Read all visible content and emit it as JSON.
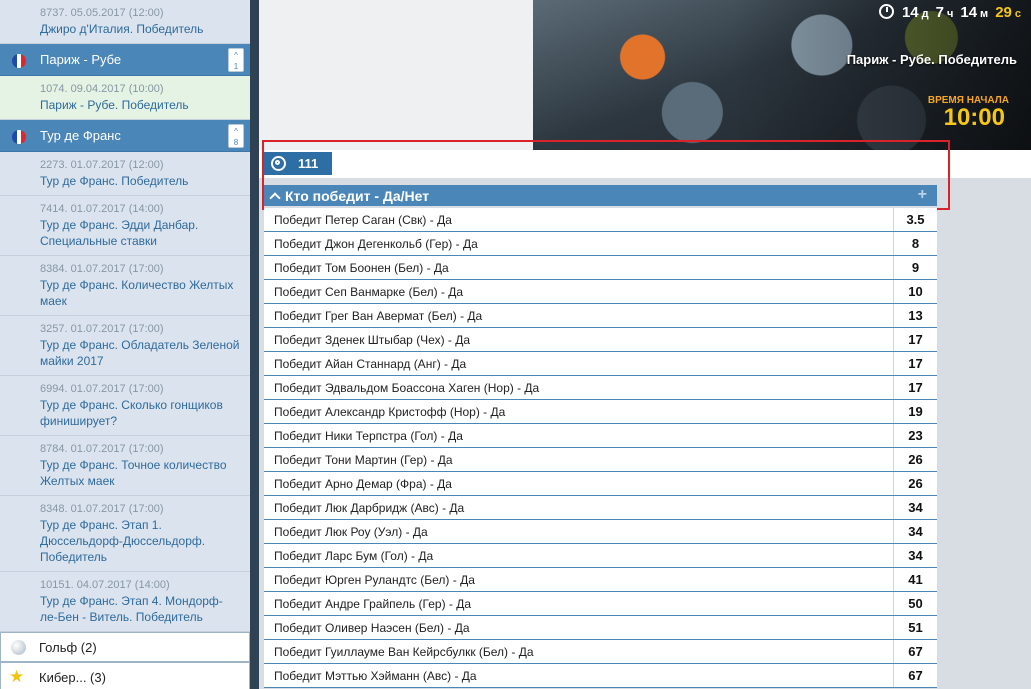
{
  "sidebar": {
    "top_event": {
      "meta": "8737. 05.05.2017 (12:00)",
      "title": "Джиро д'Италия. Победитель"
    },
    "categories": [
      {
        "name": "Париж - Рубе",
        "count": "1",
        "events": [
          {
            "meta": "1074. 09.04.2017 (10:00)",
            "title": "Париж - Рубе. Победитель",
            "active": true
          }
        ]
      },
      {
        "name": "Тур де Франс",
        "count": "8",
        "events": [
          {
            "meta": "2273. 01.07.2017 (12:00)",
            "title": "Тур де Франс. Победитель"
          },
          {
            "meta": "7414. 01.07.2017 (14:00)",
            "title": "Тур де Франс. Эдди Данбар. Специальные ставки"
          },
          {
            "meta": "8384. 01.07.2017 (17:00)",
            "title": "Тур де Франс. Количество Желтых маек"
          },
          {
            "meta": "3257. 01.07.2017 (17:00)",
            "title": "Тур де Франс. Обладатель Зеленой майки 2017"
          },
          {
            "meta": "6994. 01.07.2017 (17:00)",
            "title": "Тур де Франс. Сколько гонщиков финиширует?"
          },
          {
            "meta": "8784. 01.07.2017 (17:00)",
            "title": "Тур де Франс. Точное количество Желтых маек"
          },
          {
            "meta": "8348. 01.07.2017 (17:00)",
            "title": "Тур де Франс. Этап 1. Дюссельдорф-Дюссельдорф. Победитель"
          },
          {
            "meta": "10151. 04.07.2017 (14:00)",
            "title": "Тур де Франс. Этап 4. Мондорф-ле-Бен - Витель. Победитель"
          }
        ]
      }
    ],
    "sports": [
      {
        "label": "Гольф (2)",
        "icon": "golf-ball-icon"
      },
      {
        "label": "Кибер... (3)",
        "icon": "star-icon"
      }
    ]
  },
  "banner": {
    "countdown": {
      "days": "14",
      "days_unit": "д",
      "hours": "7",
      "hours_unit": "ч",
      "minutes": "14",
      "minutes_unit": "м",
      "seconds": "29",
      "seconds_unit": "с"
    },
    "title": "Париж - Рубе. Победитель",
    "start_label": "ВРЕМЯ НАЧАЛА",
    "start_time": "10:00"
  },
  "event_tab": {
    "id": "111",
    "icon": "target-icon"
  },
  "market": {
    "title": "Кто победит - Да/Нет",
    "expand_icon": "+",
    "rows": [
      {
        "name": "Победит Петер Саган (Свк) - Да",
        "odd": "3.5"
      },
      {
        "name": "Победит Джон Дегенкольб (Гер) - Да",
        "odd": "8"
      },
      {
        "name": "Победит Том Боонен (Бел) - Да",
        "odd": "9"
      },
      {
        "name": "Победит Сеп Ванмарке (Бел) - Да",
        "odd": "10"
      },
      {
        "name": "Победит Грег Ван Авермат (Бел) - Да",
        "odd": "13"
      },
      {
        "name": "Победит Зденек Штыбар (Чех) - Да",
        "odd": "17"
      },
      {
        "name": "Победит Айан Станнард (Анг) - Да",
        "odd": "17"
      },
      {
        "name": "Победит Эдвальдом Боассона Хаген (Нор) - Да",
        "odd": "17"
      },
      {
        "name": "Победит Александр Кристофф (Нор) - Да",
        "odd": "19"
      },
      {
        "name": "Победит Ники Терпстра (Гол) - Да",
        "odd": "23"
      },
      {
        "name": "Победит Тони Мартин (Гер) - Да",
        "odd": "26"
      },
      {
        "name": "Победит Арно Демар (Фра) - Да",
        "odd": "26"
      },
      {
        "name": "Победит Люк Дарбридж (Авс) - Да",
        "odd": "34"
      },
      {
        "name": "Победит Люк Роу (Уэл) - Да",
        "odd": "34"
      },
      {
        "name": "Победит Ларс Бум (Гол) - Да",
        "odd": "34"
      },
      {
        "name": "Победит Юрген Руландтс (Бел) - Да",
        "odd": "41"
      },
      {
        "name": "Победит Андре Грайпель (Гер) - Да",
        "odd": "50"
      },
      {
        "name": "Победит Оливер Наэсен (Бел) - Да",
        "odd": "51"
      },
      {
        "name": "Победит Гуиллауме Ван Кейрсбулкк (Бел) - Да",
        "odd": "67"
      },
      {
        "name": "Победит Мэттью Хэйманн (Авс) - Да",
        "odd": "67"
      }
    ]
  },
  "colors": {
    "accent": "#4a86b7",
    "dark": "#2f4253",
    "highlight": "#d9232a",
    "gold": "#f5c518"
  }
}
